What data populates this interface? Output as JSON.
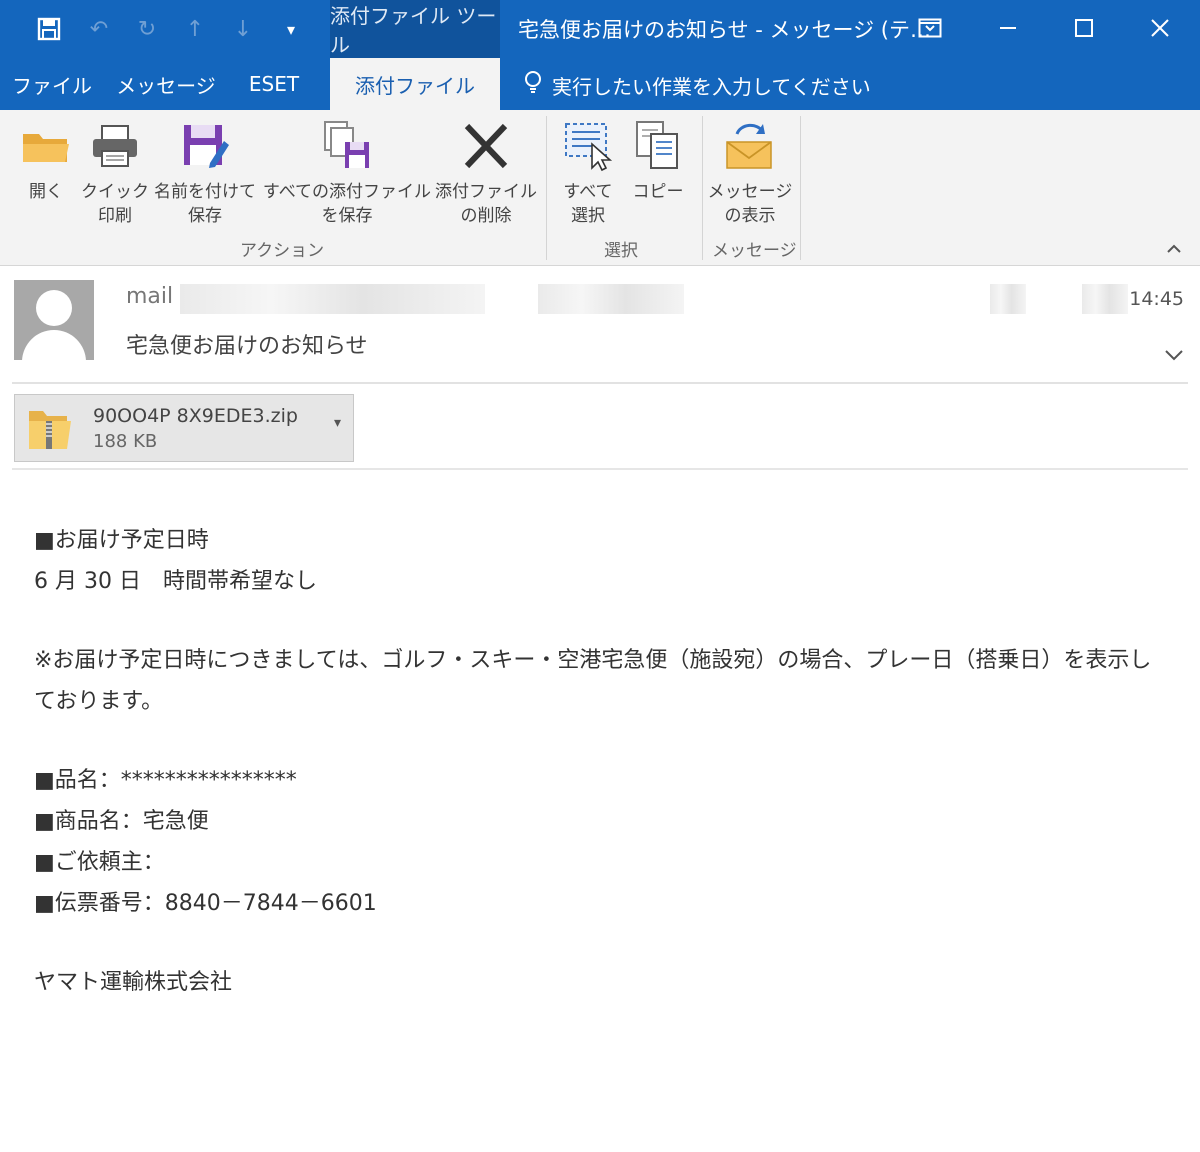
{
  "titlebar": {
    "context_tab_label": "添付ファイル ツール",
    "window_title": "宅急便お届けのお知らせ - メッセージ (テ…",
    "qat_icons": [
      "save-icon",
      "undo-icon",
      "redo-icon",
      "up-icon",
      "down-icon",
      "customize-icon"
    ],
    "window_buttons": [
      "ribbon-display-icon",
      "minimize-icon",
      "maximize-icon",
      "close-icon"
    ]
  },
  "tabs": [
    {
      "label": "ファイル",
      "active": false
    },
    {
      "label": "メッセージ",
      "active": false
    },
    {
      "label": "ESET",
      "active": false
    },
    {
      "label": "添付ファイル",
      "active": true
    }
  ],
  "tellme": {
    "text": "実行したい作業を入力してください"
  },
  "ribbon": {
    "groups": [
      {
        "label": "アクション",
        "buttons": [
          {
            "line1": "開く",
            "line2": "",
            "icon": "folder-icon"
          },
          {
            "line1": "クイック",
            "line2": "印刷",
            "icon": "printer-icon"
          },
          {
            "line1": "名前を付けて",
            "line2": "保存",
            "icon": "save-as-icon"
          },
          {
            "line1": "すべての添付ファイル",
            "line2": "を保存",
            "icon": "save-all-icon"
          },
          {
            "line1": "添付ファイル",
            "line2": "の削除",
            "icon": "delete-icon"
          }
        ]
      },
      {
        "label": "選択",
        "buttons": [
          {
            "line1": "すべて",
            "line2": "選択",
            "icon": "select-all-icon"
          },
          {
            "line1": "コピー",
            "line2": "",
            "icon": "copy-icon"
          }
        ]
      },
      {
        "label": "メッセージ",
        "buttons": [
          {
            "line1": "メッセージ",
            "line2": "の表示",
            "icon": "show-message-icon"
          }
        ]
      }
    ]
  },
  "header": {
    "sender_prefix": "mail",
    "time": "14:45",
    "subject": "宅急便お届けのお知らせ"
  },
  "attachment": {
    "filename": "90OO4P 8X9EDE3.zip",
    "size": "188 KB",
    "icon": "zip-folder-icon"
  },
  "body": {
    "line1": "■お届け予定日時",
    "line2": "6 月 30 日　時間帯希望なし",
    "line3": "※お届け予定日時につきましては、ゴルフ・スキー・空港宅急便（施設宛）の場合、プレー日（搭乗日）を表示しております。",
    "line4": "■品名：****************",
    "line5": "■商品名：宅急便",
    "line6": "■ご依頼主：",
    "line7": "■伝票番号：8840－7844－6601",
    "line8": "ヤマト運輸株式会社"
  },
  "colors": {
    "titlebar_bg": "#1466bd",
    "context_tab_bg": "#10539c",
    "ribbon_bg": "#f3f3f3",
    "active_tab_text": "#1a5fb0"
  }
}
